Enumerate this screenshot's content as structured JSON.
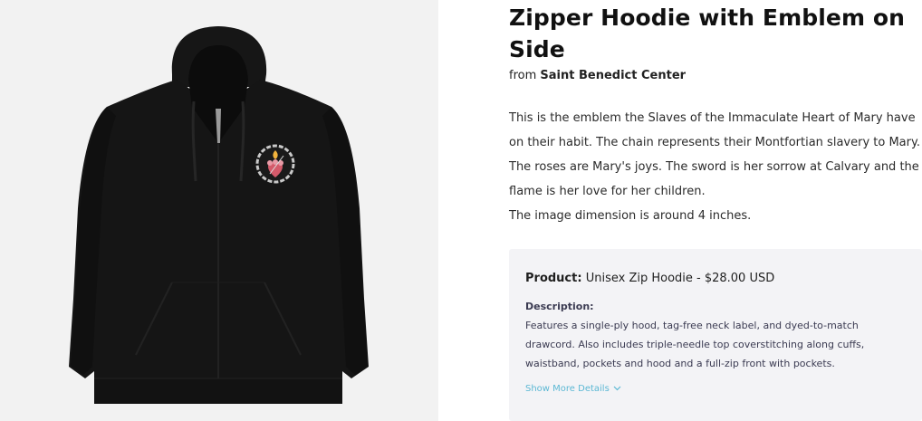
{
  "product": {
    "title": "Zipper Hoodie with Emblem on Side",
    "from_prefix": "from",
    "seller": "Saint Benedict Center",
    "description_paragraph_1": "This is the emblem the Slaves of the Immaculate Heart of Mary have on their habit. The chain represents their Montfortian slavery to Mary. The roses are Mary's joys. The sword is her sorrow at Calvary and the flame is her love for her children.",
    "description_paragraph_2": "The image dimension is around 4 inches.",
    "image_icon": "hoodie-image"
  },
  "details": {
    "product_label": "Product:",
    "product_value": "Unisex Zip Hoodie - $28.00 USD",
    "description_label": "Description:",
    "description_text": "Features a single-ply hood, tag-free neck label, and dyed-to-match drawcord. Also includes triple-needle top coverstitching along cuffs, waistband, pockets and hood and a full-zip front with pockets.",
    "show_more_label": "Show More Details",
    "show_more_icon": "chevron-down-icon"
  },
  "colors": {
    "image_background": "#f2f2f2",
    "hoodie": "#151515",
    "details_background": "#f3f3f6",
    "link": "#5cb8d4",
    "details_text": "#3b3b52"
  }
}
